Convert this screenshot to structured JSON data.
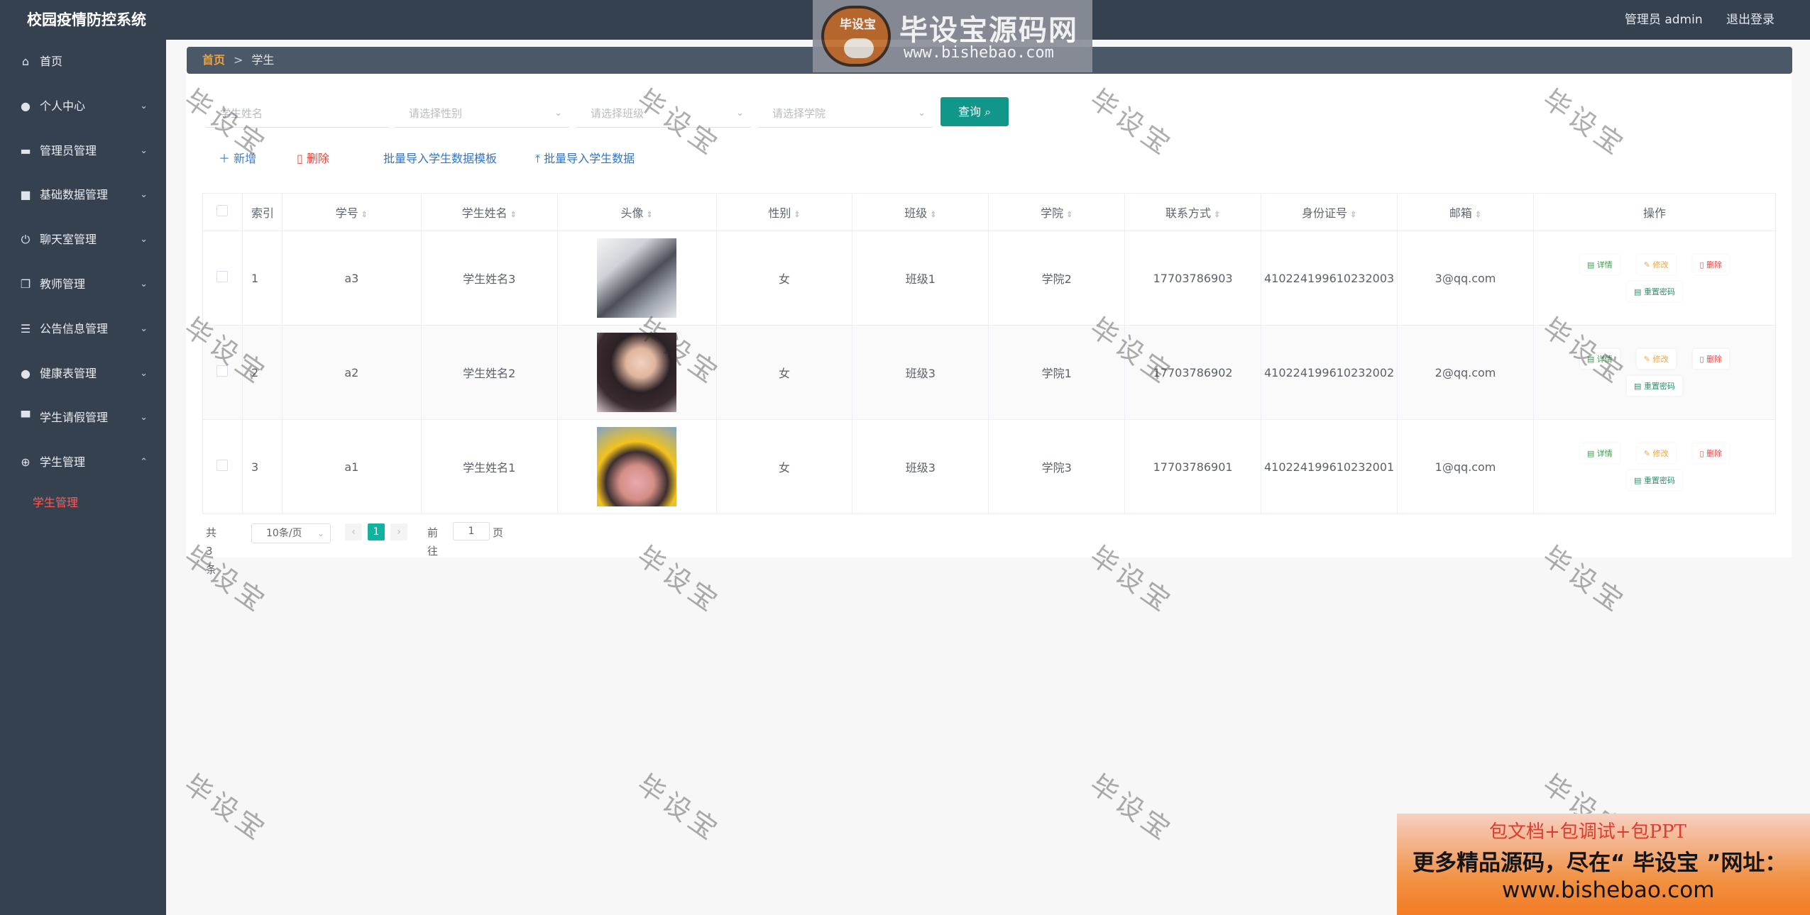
{
  "app": {
    "title": "校园疫情防控系统",
    "user_label": "管理员 admin",
    "logout_label": "退出登录"
  },
  "watermark_logo": {
    "badge_text": "毕设宝",
    "title": "毕设宝源码网",
    "url": "www.bishebao.com"
  },
  "watermark_text": "毕设宝",
  "sidebar": {
    "items": [
      {
        "label": "首页",
        "icon": "home-icon"
      },
      {
        "label": "个人中心",
        "icon": "user-icon"
      },
      {
        "label": "管理员管理",
        "icon": "monitor-icon"
      },
      {
        "label": "基础数据管理",
        "icon": "briefcase-icon"
      },
      {
        "label": "聊天室管理",
        "icon": "power-icon"
      },
      {
        "label": "教师管理",
        "icon": "copy-icon"
      },
      {
        "label": "公告信息管理",
        "icon": "sliders-icon"
      },
      {
        "label": "健康表管理",
        "icon": "location-icon"
      },
      {
        "label": "学生请假管理",
        "icon": "chat-icon"
      },
      {
        "label": "学生管理",
        "icon": "crosshair-icon"
      }
    ],
    "active_sub": "学生管理"
  },
  "breadcrumb": {
    "home": "首页",
    "separator": ">",
    "current": "学生"
  },
  "filters": {
    "name_placeholder": "学生姓名",
    "gender_placeholder": "请选择性别",
    "class_placeholder": "请选择班级",
    "college_placeholder": "请选择学院",
    "query_label": "查询"
  },
  "actions": {
    "add": "新增",
    "delete": "删除",
    "import_template": "批量导入学生数据模板",
    "import_data": "批量导入学生数据"
  },
  "table": {
    "headers": [
      "索引",
      "学号",
      "学生姓名",
      "头像",
      "性别",
      "班级",
      "学院",
      "联系方式",
      "身份证号",
      "邮箱",
      "操作"
    ],
    "rows": [
      {
        "index": "1",
        "no": "a3",
        "name": "学生姓名3",
        "gender": "女",
        "class": "班级1",
        "college": "学院2",
        "phone": "17703786903",
        "id_card": "410224199610232003",
        "email": "3@qq.com"
      },
      {
        "index": "2",
        "no": "a2",
        "name": "学生姓名2",
        "gender": "女",
        "class": "班级3",
        "college": "学院1",
        "phone": "17703786902",
        "id_card": "410224199610232002",
        "email": "2@qq.com"
      },
      {
        "index": "3",
        "no": "a1",
        "name": "学生姓名1",
        "gender": "女",
        "class": "班级3",
        "college": "学院3",
        "phone": "17703786901",
        "id_card": "410224199610232001",
        "email": "1@qq.com"
      }
    ],
    "op_labels": {
      "detail": "详情",
      "edit": "修改",
      "delete": "删除",
      "reset": "重置密码"
    }
  },
  "pagination": {
    "total": "共 3 条",
    "page_size": "10条/页",
    "prev": "‹",
    "next": "›",
    "current": "1",
    "goto_label": "前往",
    "goto_value": "1",
    "page_label": "页"
  },
  "promo": {
    "line1": "包文档+包调试+包PPT",
    "line2": "更多精品源码，尽在“ 毕设宝 ”网址：",
    "line3": "www.bishebao.com"
  },
  "colors": {
    "header_bg": "#364150",
    "accent": "#11978a",
    "active_red": "#ff5a5a",
    "breadcrumb_home": "#f0a13c"
  }
}
